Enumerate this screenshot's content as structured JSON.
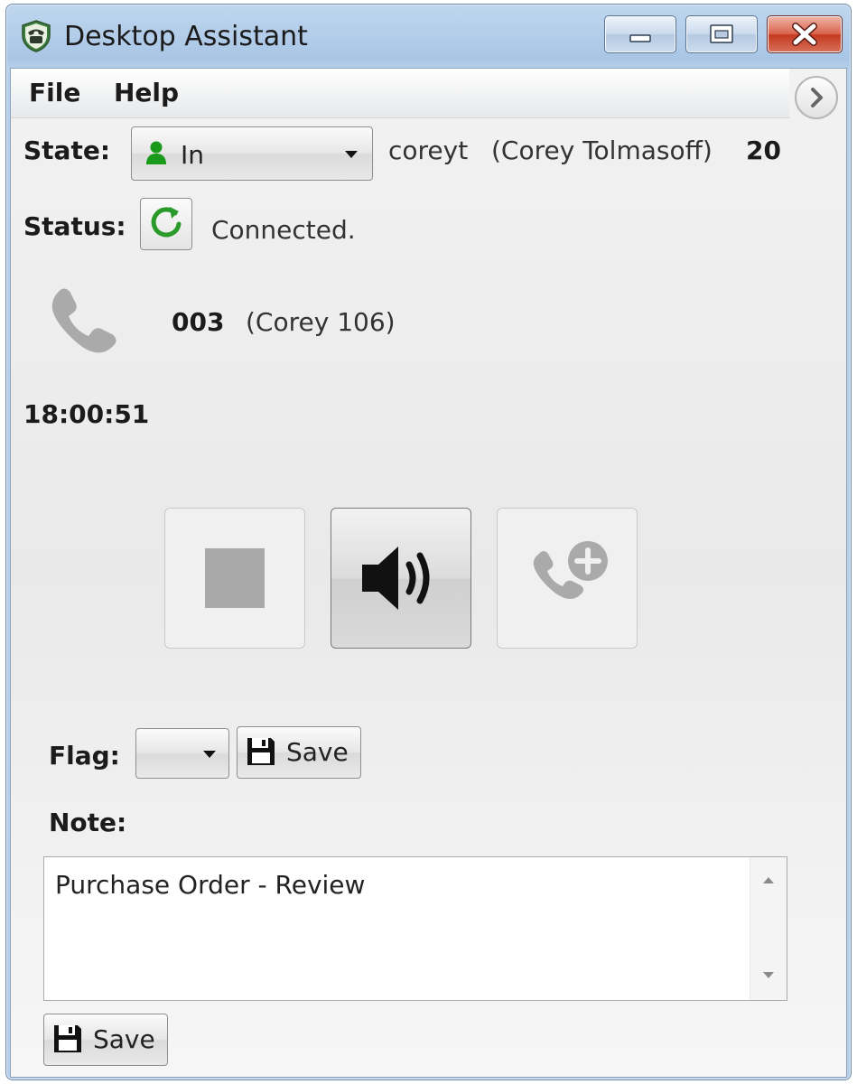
{
  "window": {
    "title": "Desktop Assistant"
  },
  "menu": {
    "file": "File",
    "help": "Help"
  },
  "state": {
    "label": "State:",
    "value": "In",
    "username": "coreyt",
    "fullname": "(Corey Tolmasoff)",
    "extension": "20"
  },
  "status": {
    "label": "Status:",
    "text": "Connected."
  },
  "call": {
    "number": "003",
    "name": "(Corey 106)",
    "time": "18:00:51"
  },
  "flag": {
    "label": "Flag:",
    "value": "",
    "save_label": "Save"
  },
  "note": {
    "label": "Note:",
    "text": "Purchase Order - Review",
    "save_label": "Save"
  },
  "colors": {
    "state_in": "#1a9a1a",
    "refresh_green": "#2a9a2a",
    "inactive_icon": "#aaaaaa"
  }
}
